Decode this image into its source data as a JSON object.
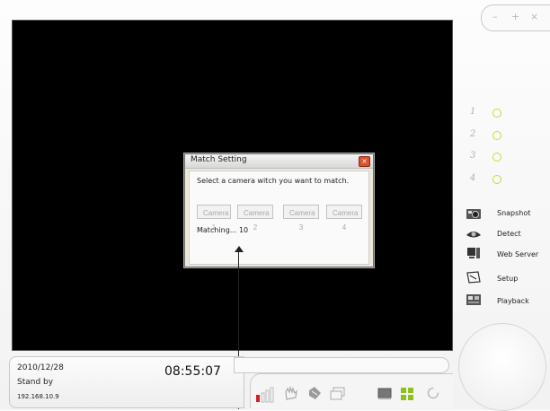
{
  "window": {
    "minimize_glyph": "–",
    "maximize_glyph": "+",
    "close_glyph": "×"
  },
  "dialog": {
    "title": "Match Setting",
    "prompt": "Select a camera witch you want to match.",
    "camera_buttons": [
      "Camera 1",
      "Camera 2",
      "Camera 3",
      "Camera 4"
    ],
    "matching_label": "Matching... 10"
  },
  "channels": [
    "1",
    "2",
    "3",
    "4"
  ],
  "menu": {
    "snapshot": "Snapshot",
    "detect": "Detect",
    "web_server": "Web Server",
    "setup": "Setup",
    "playback": "Playback"
  },
  "status": {
    "date": "2010/12/28",
    "time": "08:55:07",
    "state": "Stand by",
    "ip": "192.168.10.9"
  },
  "colors": {
    "channel_indicator": "#cbd932",
    "video_bg": "#000000",
    "record_red": "#d81e1e",
    "grid_green": "#8bc21f"
  },
  "icons": {
    "menu": [
      "camera-icon",
      "detect-eye-icon",
      "web-server-icon",
      "setup-icon",
      "playback-icon"
    ],
    "toolbar": [
      "record-bars-icon",
      "pan-hand-icon",
      "move-hand-icon",
      "window-icon",
      "single-view-icon",
      "quad-view-icon",
      "refresh-icon"
    ]
  }
}
